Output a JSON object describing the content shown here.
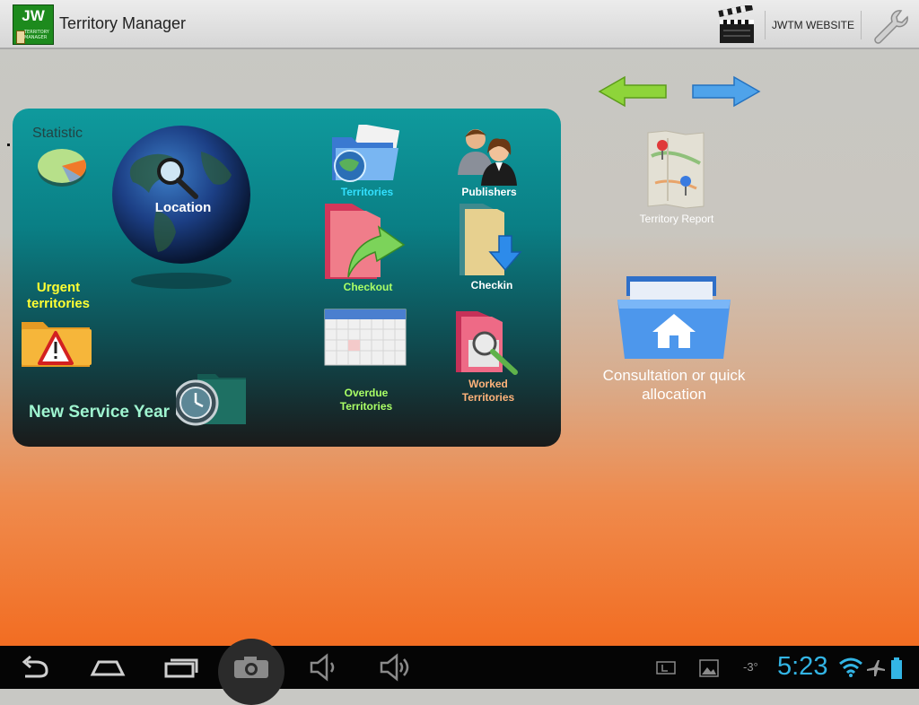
{
  "app": {
    "title": "Territory Manager",
    "logo_text": "JW",
    "logo_subtext": "TERRITORY MANAGER"
  },
  "action_bar": {
    "website_label": "JWTM WEBSITE"
  },
  "panel": {
    "statistic_label": "Statistic",
    "location_label": "Location",
    "urgent_label": "Urgent territories",
    "new_year_label": "New Service Year",
    "territories_label": "Territories",
    "publishers_label": "Publishers",
    "checkout_label": "Checkout",
    "checkin_label": "Checkin",
    "overdue_label": "Overdue Territories",
    "worked_label": "Worked Territories"
  },
  "side": {
    "report_label": "Territory Report",
    "consult_label": "Consultation or quick allocation"
  },
  "status_bar": {
    "time": "5:23",
    "temperature": "-3°"
  },
  "colors": {
    "accent_clock": "#33b5e5",
    "label_white": "#ffffff",
    "label_yellow": "#ffff33",
    "label_cyan": "#33e0ff",
    "label_green": "#aaff66",
    "label_peach": "#ffb37a"
  }
}
